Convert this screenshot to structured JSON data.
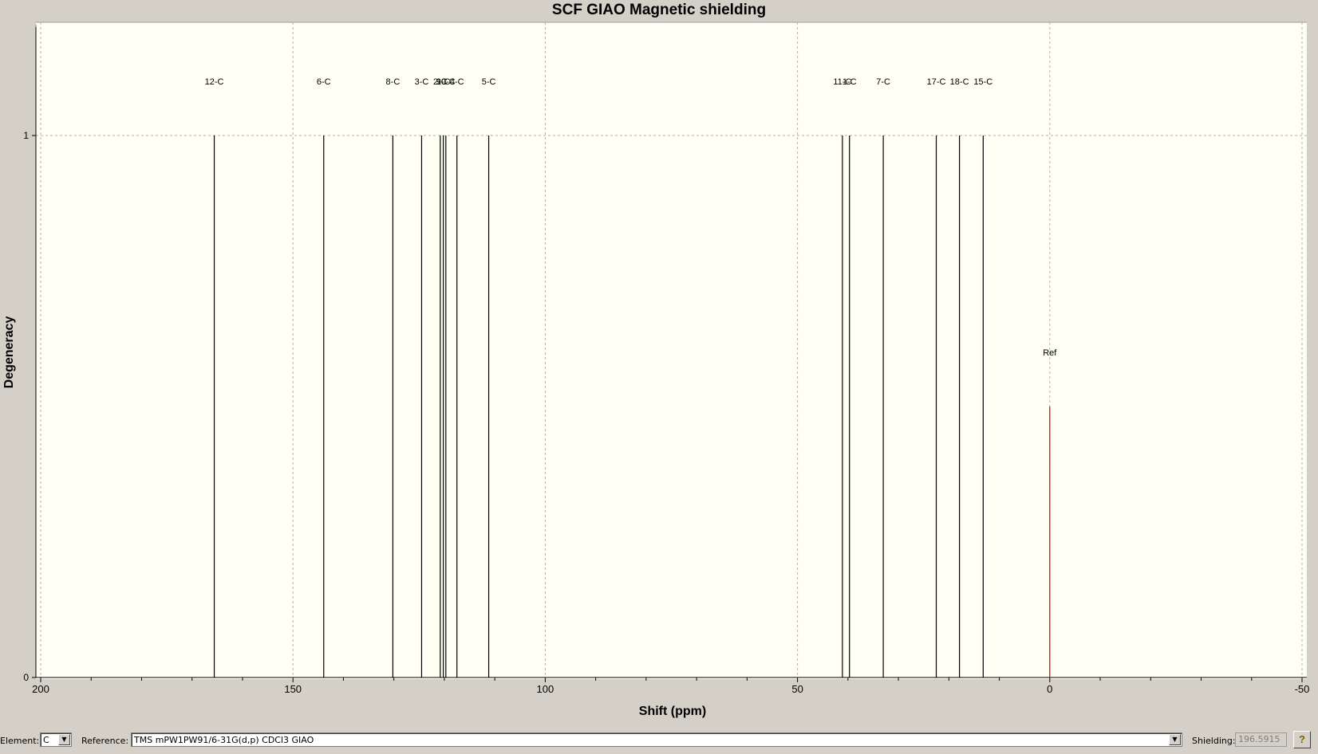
{
  "window": {
    "title": "SCF GIAO Magnetic shielding"
  },
  "chart_data": {
    "type": "stick",
    "title": "SCF GIAO Magnetic shielding",
    "xlabel": "Shift (ppm)",
    "ylabel": "Degeneracy",
    "xlim": [
      200,
      -50
    ],
    "ylim": [
      0,
      1.2
    ],
    "x_ticks": [
      200,
      150,
      100,
      50,
      0,
      -50
    ],
    "y_ticks": [
      0,
      1
    ],
    "grid": true,
    "peaks": [
      {
        "label": "12-C",
        "x": 165.6,
        "y": 1
      },
      {
        "label": "6-C",
        "x": 143.9,
        "y": 1
      },
      {
        "label": "8-C",
        "x": 130.2,
        "y": 1
      },
      {
        "label": "3-C",
        "x": 124.5,
        "y": 1
      },
      {
        "label": "2-C",
        "x": 120.8,
        "y": 1
      },
      {
        "label": "9-C",
        "x": 120.2,
        "y": 1
      },
      {
        "label": "10-C",
        "x": 119.7,
        "y": 1
      },
      {
        "label": "4-C",
        "x": 117.5,
        "y": 1
      },
      {
        "label": "5-C",
        "x": 111.2,
        "y": 1
      },
      {
        "label": "11-C",
        "x": 41.1,
        "y": 1
      },
      {
        "label": "1-C",
        "x": 39.7,
        "y": 1
      },
      {
        "label": "7-C",
        "x": 33.0,
        "y": 1
      },
      {
        "label": "17-C",
        "x": 22.5,
        "y": 1
      },
      {
        "label": "18-C",
        "x": 17.9,
        "y": 1
      },
      {
        "label": "15-C",
        "x": 13.2,
        "y": 1
      }
    ],
    "reference": {
      "label": "Ref",
      "x": 0,
      "y": 0.5,
      "color": "#cc0000"
    },
    "colors": {
      "plot_bg": "#fffff4",
      "stick": "#000000",
      "grid": "#b0b0b0"
    }
  },
  "toolbar": {
    "element_label": "Element:",
    "element_value": "C",
    "reference_label": "Reference:",
    "reference_value": "TMS mPW1PW91/6-31G(d,p) CDCl3 GIAO",
    "shielding_label": "Shielding:",
    "shielding_value": "196.5915",
    "help_icon": "?"
  }
}
